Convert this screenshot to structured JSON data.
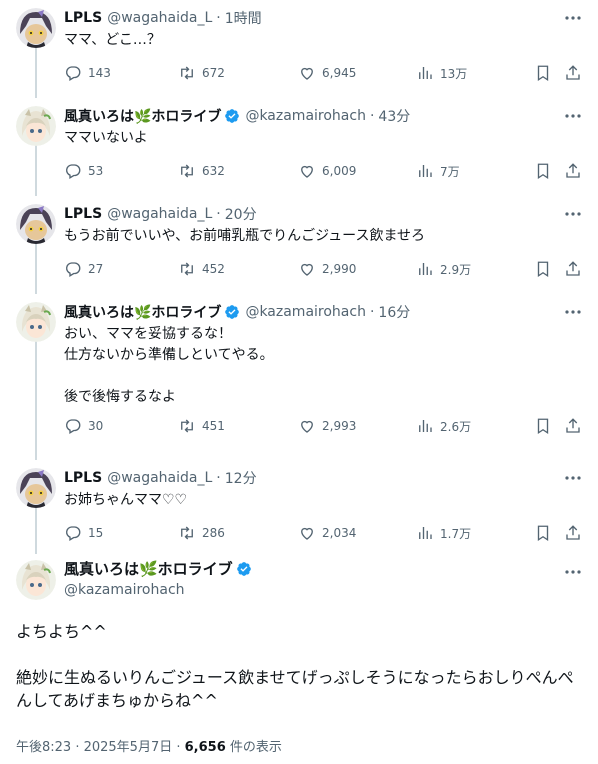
{
  "thread": [
    {
      "author": "LPLS",
      "handle": "@wagahaida_L",
      "time": "1時間",
      "text": "ママ、どこ…？",
      "avatar": "lpls",
      "verified": false,
      "stats": {
        "replies": "143",
        "retweets": "672",
        "likes": "6,945",
        "views": "13万"
      }
    },
    {
      "author": "風真いろは🌿ホロライブ",
      "handle": "@kazamairohach",
      "time": "43分",
      "text": "ママいないよ",
      "avatar": "iroha",
      "verified": true,
      "stats": {
        "replies": "53",
        "retweets": "632",
        "likes": "6,009",
        "views": "7万"
      }
    },
    {
      "author": "LPLS",
      "handle": "@wagahaida_L",
      "time": "20分",
      "text": "もうお前でいいや、お前哺乳瓶でりんごジュース飲ませろ",
      "avatar": "lpls",
      "verified": false,
      "stats": {
        "replies": "27",
        "retweets": "452",
        "likes": "2,990",
        "views": "2.9万"
      }
    },
    {
      "author": "風真いろは🌿ホロライブ",
      "handle": "@kazamairohach",
      "time": "16分",
      "text": "おい、ママを妥協するな！\n仕方ないから準備しといてやる。\n\n後で後悔するなよ",
      "avatar": "iroha",
      "verified": true,
      "stats": {
        "replies": "30",
        "retweets": "451",
        "likes": "2,993",
        "views": "2.6万"
      }
    },
    {
      "author": "LPLS",
      "handle": "@wagahaida_L",
      "time": "12分",
      "text": "お姉ちゃんママ♡♡",
      "avatar": "lpls",
      "verified": false,
      "stats": {
        "replies": "15",
        "retweets": "286",
        "likes": "2,034",
        "views": "1.7万"
      }
    }
  ],
  "main_tweet": {
    "author": "風真いろは🌿ホロライブ",
    "handle": "@kazamairohach",
    "verified": true,
    "text": "よちよち^^\n\n絶妙に生ぬるいりんごジュース飲ませてげっぷしそうになったらおしりぺんぺんしてあげまちゅからね^^",
    "timestamp": "午後8:23 · 2025年5月7日 · ",
    "views_count": "6,656",
    "views_suffix": " 件の表示"
  },
  "colors": {
    "text": "#0f1419",
    "secondary": "#536471",
    "verified": "#1d9bf0",
    "thread_line": "#cfd9de"
  },
  "icons": [
    "more-icon",
    "reply-icon",
    "retweet-icon",
    "like-icon",
    "views-icon",
    "bookmark-icon",
    "share-icon",
    "verified-badge-icon"
  ]
}
